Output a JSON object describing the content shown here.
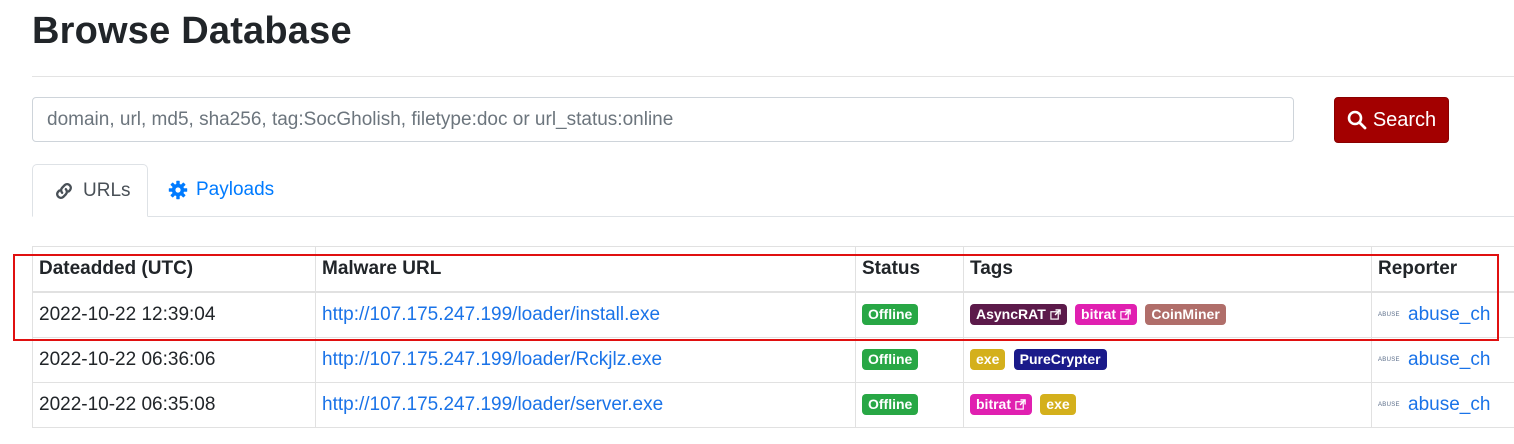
{
  "page": {
    "title": "Browse Database"
  },
  "search": {
    "placeholder": "domain, url, md5, sha256, tag:SocGholish, filetype:doc or url_status:online",
    "button_label": "Search",
    "button_color": "#a30000"
  },
  "tabs": [
    {
      "label": "URLs",
      "icon": "link-icon",
      "active": true
    },
    {
      "label": "Payloads",
      "icon": "gear-icon",
      "active": false
    }
  ],
  "table": {
    "columns": [
      "Dateadded (UTC)",
      "Malware URL",
      "Status",
      "Tags",
      "Reporter"
    ],
    "rows": [
      {
        "date": "2022-10-22 12:39:04",
        "url": "http://107.175.247.199/loader/install.exe",
        "status": "Offline",
        "tags": [
          {
            "label": "AsyncRAT",
            "color": "#5c1a4a",
            "external": true
          },
          {
            "label": "bitrat",
            "color": "#e020b0",
            "external": true
          },
          {
            "label": "CoinMiner",
            "color": "#b06e6a",
            "external": false
          }
        ],
        "reporter": "abuse_ch",
        "highlighted": true
      },
      {
        "date": "2022-10-22 06:36:06",
        "url": "http://107.175.247.199/loader/Rckjlz.exe",
        "status": "Offline",
        "tags": [
          {
            "label": "exe",
            "color": "#d4b01c",
            "external": false
          },
          {
            "label": "PureCrypter",
            "color": "#1a1a8a",
            "external": false
          }
        ],
        "reporter": "abuse_ch",
        "highlighted": false
      },
      {
        "date": "2022-10-22 06:35:08",
        "url": "http://107.175.247.199/loader/server.exe",
        "status": "Offline",
        "tags": [
          {
            "label": "bitrat",
            "color": "#e020b0",
            "external": true
          },
          {
            "label": "exe",
            "color": "#d4b01c",
            "external": false
          }
        ],
        "reporter": "abuse_ch",
        "highlighted": false
      }
    ]
  },
  "reporter_logo_text": "ABUSE",
  "colors": {
    "status_offline": "#28a745",
    "link": "#1a73e8",
    "highlight": "#e01010"
  }
}
